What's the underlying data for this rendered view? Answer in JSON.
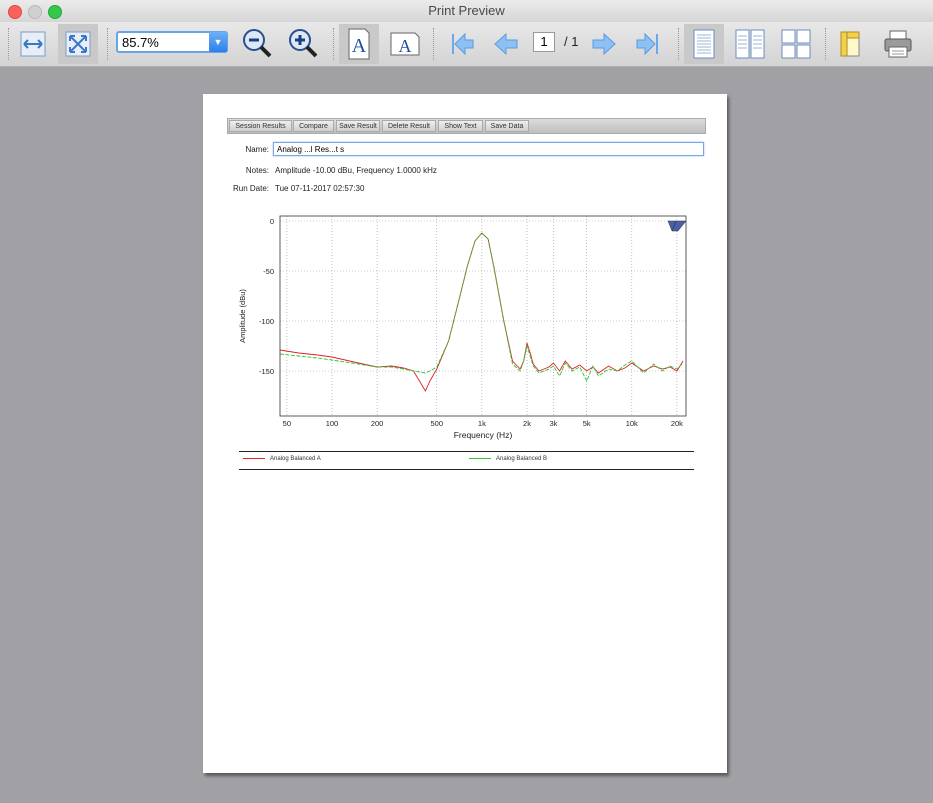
{
  "window": {
    "title": "Print Preview"
  },
  "toolbar": {
    "zoom_value": "85.7%",
    "page_current": "1",
    "page_total": "/ 1",
    "icons": [
      "fit-width-icon",
      "fit-page-icon",
      "zoom-out-icon",
      "zoom-in-icon",
      "portrait-icon",
      "landscape-icon",
      "first-page-icon",
      "previous-page-icon",
      "next-page-icon",
      "last-page-icon",
      "single-page-icon",
      "facing-pages-icon",
      "four-pages-icon",
      "page-setup-icon",
      "print-icon"
    ]
  },
  "paper": {
    "tabs": [
      "Session Results",
      "Compare",
      "Save Result",
      "Delete Result",
      "Show Text",
      "Save Data"
    ],
    "name_label": "Name:",
    "name_value": "Analog ...l Res...t s",
    "notes_label": "Notes:",
    "notes_value": "Amplitude -10.00 dBu, Frequency 1.0000 kHz",
    "rundate_label": "Run Date:",
    "rundate_value": "Tue 07-11-2017 02:57:30"
  },
  "chart_data": {
    "type": "line",
    "xlabel": "Frequency (Hz)",
    "ylabel": "Amplitude (dBu)",
    "xscale": "log",
    "xlim": [
      45,
      23000
    ],
    "ylim": [
      -195,
      5
    ],
    "xticks": [
      50,
      100,
      200,
      500,
      1000,
      2000,
      3000,
      5000,
      10000,
      20000
    ],
    "xtick_labels": [
      "50",
      "100",
      "200",
      "500",
      "1k",
      "2k",
      "3k",
      "5k",
      "10k",
      "20k"
    ],
    "yticks": [
      0,
      -50,
      -100,
      -150
    ],
    "ytick_labels": [
      "0",
      "-50",
      "-100",
      "-150"
    ],
    "grid": true,
    "legend_position": "bottom",
    "colors": {
      "A": "#e0202a",
      "B": "#2ec42e"
    },
    "series": [
      {
        "name": "Analog Balanced A",
        "x": [
          45,
          60,
          80,
          100,
          150,
          200,
          250,
          300,
          350,
          420,
          450,
          500,
          600,
          700,
          800,
          900,
          1000,
          1100,
          1200,
          1400,
          1600,
          1800,
          1900,
          2000,
          2100,
          2200,
          2400,
          2600,
          2800,
          3000,
          3300,
          3600,
          4000,
          4500,
          5000,
          5500,
          6000,
          7000,
          8000,
          9000,
          10000,
          12000,
          14000,
          16000,
          18000,
          20000,
          22000
        ],
        "y": [
          -129,
          -132,
          -134,
          -136,
          -142,
          -146,
          -145,
          -147,
          -150,
          -170,
          -160,
          -148,
          -120,
          -80,
          -45,
          -20,
          -12,
          -18,
          -45,
          -100,
          -140,
          -148,
          -140,
          -122,
          -132,
          -143,
          -150,
          -148,
          -146,
          -142,
          -150,
          -140,
          -148,
          -144,
          -150,
          -146,
          -152,
          -145,
          -150,
          -147,
          -142,
          -150,
          -145,
          -148,
          -146,
          -150,
          -140
        ]
      },
      {
        "name": "Analog Balanced B",
        "x": [
          45,
          60,
          80,
          100,
          150,
          200,
          250,
          300,
          350,
          420,
          450,
          500,
          600,
          700,
          800,
          900,
          1000,
          1100,
          1200,
          1400,
          1600,
          1800,
          1900,
          2000,
          2100,
          2200,
          2400,
          2600,
          2800,
          3000,
          3300,
          3600,
          4000,
          4500,
          5000,
          5500,
          6000,
          7000,
          8000,
          9000,
          10000,
          12000,
          14000,
          16000,
          18000,
          20000,
          22000
        ],
        "y": [
          -133,
          -135,
          -137,
          -139,
          -143,
          -146,
          -146,
          -148,
          -150,
          -152,
          -150,
          -146,
          -120,
          -80,
          -45,
          -20,
          -12,
          -18,
          -45,
          -100,
          -143,
          -150,
          -140,
          -125,
          -135,
          -145,
          -152,
          -150,
          -148,
          -145,
          -155,
          -142,
          -150,
          -146,
          -160,
          -145,
          -155,
          -148,
          -150,
          -144,
          -140,
          -152,
          -143,
          -150,
          -145,
          -148,
          -142
        ]
      }
    ]
  }
}
